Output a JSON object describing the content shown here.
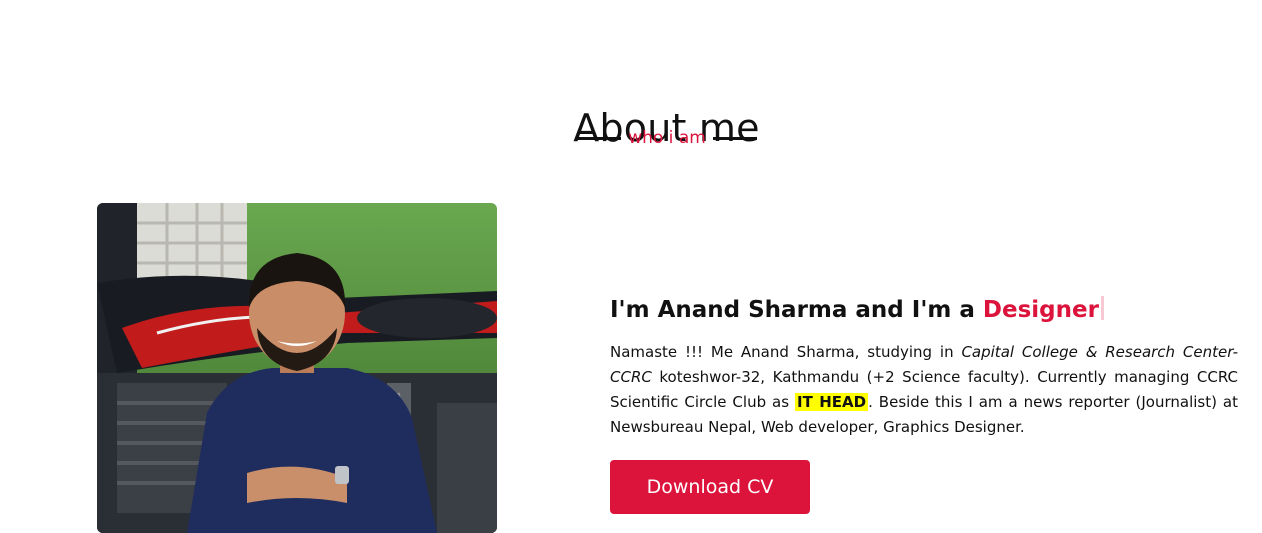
{
  "section": {
    "title": "About me",
    "subtitle": "who i am"
  },
  "profile": {
    "headline_prefix": "I'm Anand Sharma and I'm a ",
    "headline_role": "Designer",
    "bio": {
      "part1": "Namaste !!! Me Anand Sharma, studying in ",
      "college": "Capital College & Research Center-CCRC",
      "part2": " koteshwor-32, Kathmandu (+2 Science faculty). Currently managing CCRC Scientific Circle Club as ",
      "highlight": "IT HEAD",
      "part3": ". Beside this I am a news reporter (Journalist) at Newsbureau Nepal, Web developer, Graphics Designer."
    },
    "download_label": "Download CV"
  },
  "colors": {
    "accent": "#dc143c",
    "highlight": "#ffff00"
  }
}
